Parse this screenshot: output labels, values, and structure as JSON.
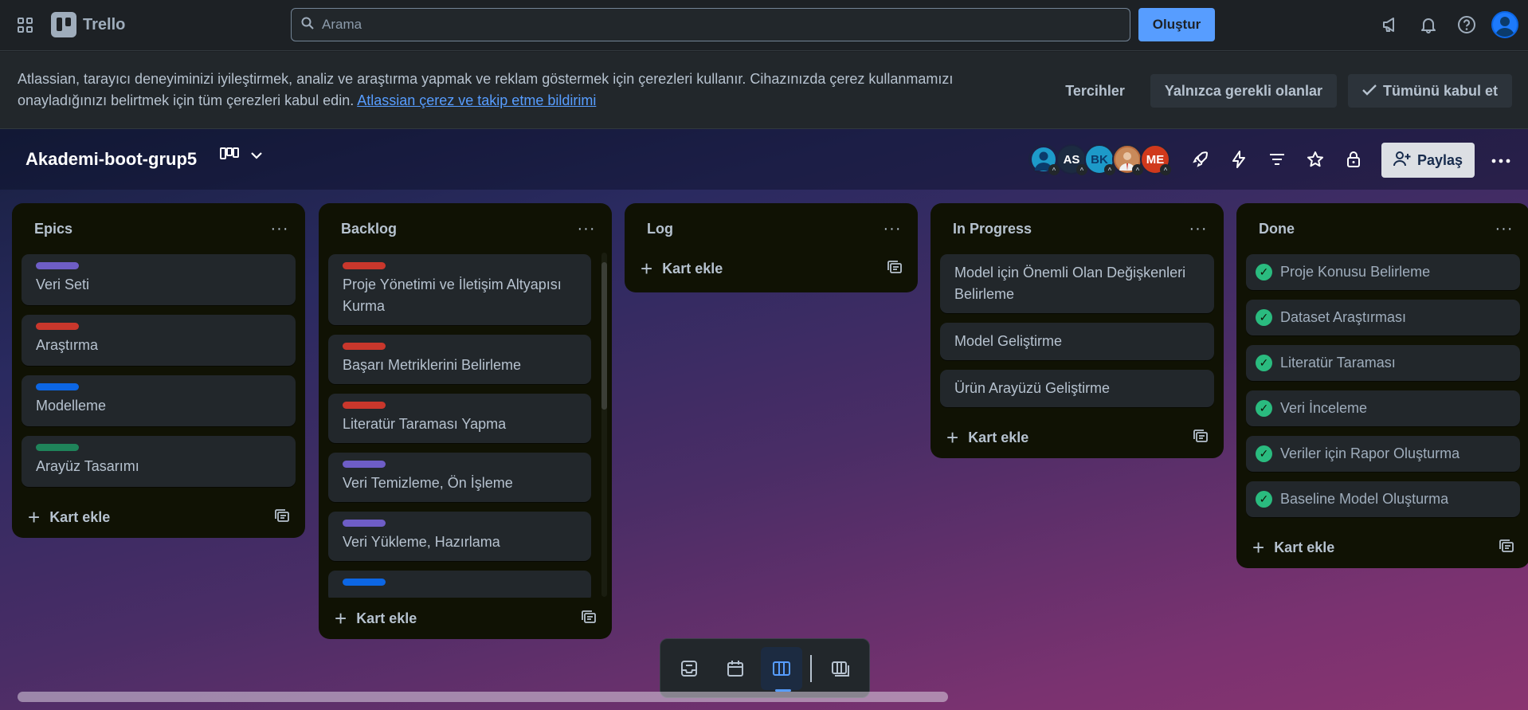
{
  "topbar": {
    "app_name": "Trello",
    "search_placeholder": "Arama",
    "create_label": "Oluştur"
  },
  "cookie_banner": {
    "text": "Atlassian, tarayıcı deneyiminizi iyileştirmek, analiz ve araştırma yapmak ve reklam göstermek için çerezleri kullanır. Cihazınızda çerez kullanmamızı onayladığınızı belirtmek için tüm çerezleri kabul edin.",
    "link_text": "Atlassian çerez ve takip etme bildirimi",
    "preferences_label": "Tercihler",
    "essential_label": "Yalnızca gerekli olanlar",
    "accept_all_label": "Tümünü kabul et"
  },
  "board": {
    "title": "Akademi-boot-grup5",
    "share_label": "Paylaş",
    "members": [
      {
        "initials": "",
        "color": "#1d9ac9"
      },
      {
        "initials": "AS",
        "color": "#1c2b41"
      },
      {
        "initials": "BK",
        "color": "#1d9ac9"
      },
      {
        "initials": "",
        "color": "#b86b3c"
      },
      {
        "initials": "ME",
        "color": "#d0391c"
      }
    ]
  },
  "lists": [
    {
      "title": "Epics",
      "add_label": "Kart ekle",
      "cards": [
        {
          "title": "Veri Seti",
          "label_color": "#6e5dc6"
        },
        {
          "title": "Araştırma",
          "label_color": "#c9372c"
        },
        {
          "title": "Modelleme",
          "label_color": "#0c66e4"
        },
        {
          "title": "Arayüz Tasarımı",
          "label_color": "#1f845a"
        }
      ]
    },
    {
      "title": "Backlog",
      "add_label": "Kart ekle",
      "cards": [
        {
          "title": "Proje Yönetimi ve İletişim Altyapısı Kurma",
          "label_color": "#c9372c"
        },
        {
          "title": "Başarı Metriklerini Belirleme",
          "label_color": "#c9372c"
        },
        {
          "title": "Literatür Taraması Yapma",
          "label_color": "#c9372c"
        },
        {
          "title": "Veri Temizleme, Ön İşleme",
          "label_color": "#6e5dc6"
        },
        {
          "title": "Veri Yükleme, Hazırlama",
          "label_color": "#6e5dc6"
        }
      ]
    },
    {
      "title": "Log",
      "add_label": "Kart ekle",
      "cards": []
    },
    {
      "title": "In Progress",
      "add_label": "Kart ekle",
      "cards": [
        {
          "title": "Model için Önemli Olan Değişkenleri Belirleme"
        },
        {
          "title": "Model Geliştirme"
        },
        {
          "title": "Ürün Arayüzü Geliştirme"
        }
      ]
    },
    {
      "title": "Done",
      "add_label": "Kart ekle",
      "cards": [
        {
          "title": "Proje Konusu Belirleme"
        },
        {
          "title": "Dataset Araştırması"
        },
        {
          "title": "Literatür Taraması"
        },
        {
          "title": "Veri İnceleme"
        },
        {
          "title": "Veriler için Rapor Oluşturma"
        },
        {
          "title": "Baseline Model Oluşturma"
        }
      ]
    }
  ],
  "accent_color": "#579dff",
  "done_check_color": "#2abb7f"
}
